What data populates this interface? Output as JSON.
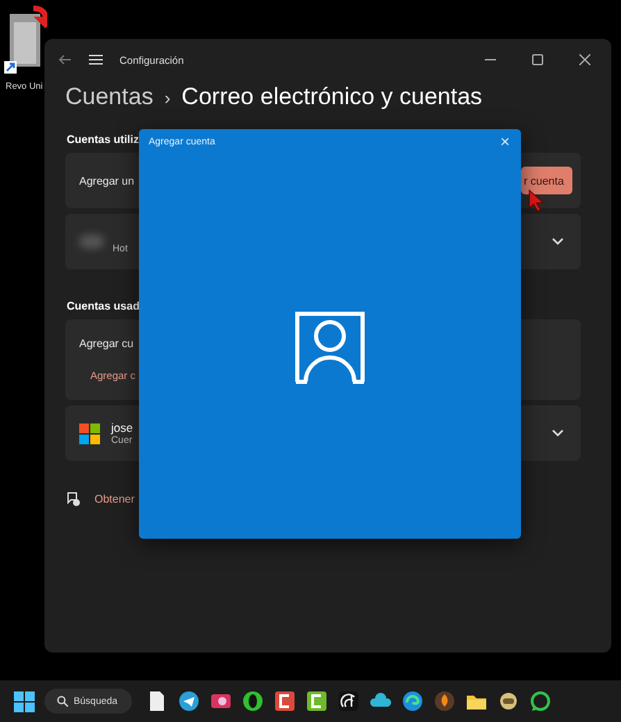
{
  "desktop_icon": {
    "label": "Revo Uni"
  },
  "window": {
    "title": "Configuración"
  },
  "breadcrumb": {
    "parent": "Cuentas",
    "separator": "›",
    "current": "Correo electrónico y cuentas"
  },
  "section_1": {
    "heading": "Cuentas utiliz",
    "add_card": {
      "label": "Agregar un",
      "button": "r cuenta"
    },
    "account_card": {
      "detail": "Hot"
    }
  },
  "section_2": {
    "heading": "Cuentas usad",
    "add_card": {
      "label": "Agregar cu",
      "link": "Agregar c"
    },
    "account_card": {
      "name": "jose",
      "detail": "Cuer"
    }
  },
  "help_link": "Obtener",
  "dialog": {
    "title": "Agregar cuenta",
    "close": "×"
  },
  "taskbar": {
    "search": "Búsqueda"
  }
}
